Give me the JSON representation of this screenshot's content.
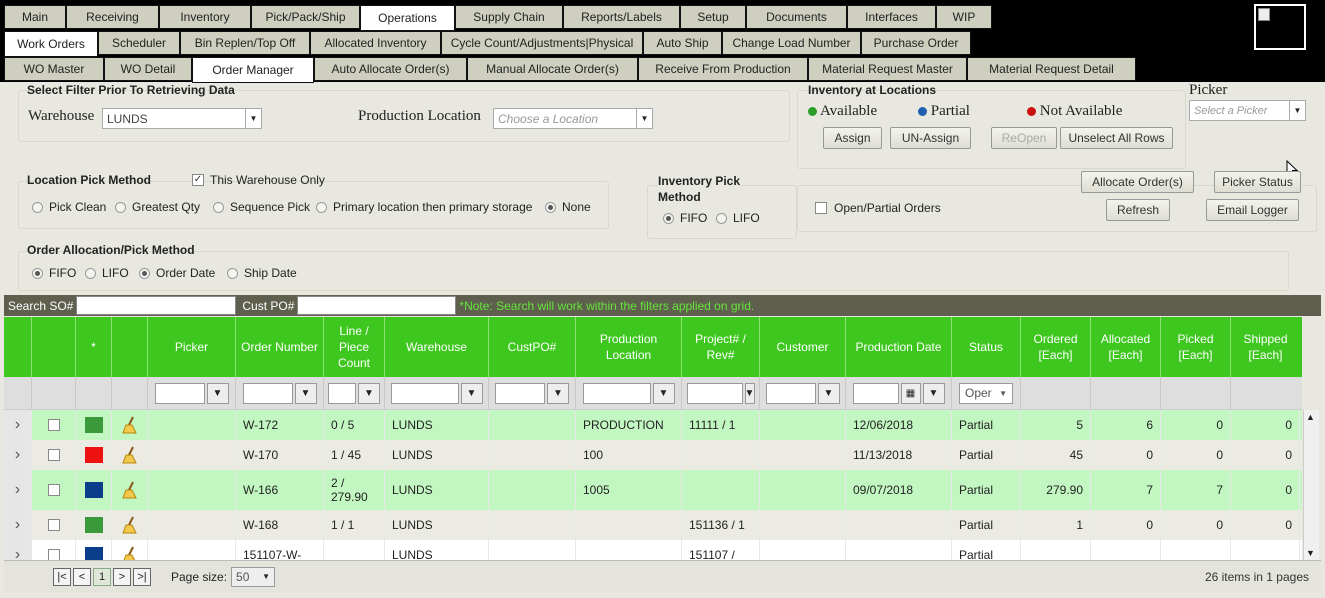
{
  "nav": {
    "main_tabs": [
      "Main",
      "Receiving",
      "Inventory",
      "Pick/Pack/Ship",
      "Operations",
      "Supply Chain",
      "Reports/Labels",
      "Setup",
      "Documents",
      "Interfaces",
      "WIP"
    ],
    "sub_tabs": [
      "Work Orders",
      "Scheduler",
      "Bin Replen/Top Off",
      "Allocated Inventory",
      "Cycle Count/Adjustments|Physical",
      "Auto Ship",
      "Change Load Number",
      "Purchase Order"
    ],
    "third_tabs": [
      "WO Master",
      "WO Detail",
      "Order Manager",
      "Auto Allocate Order(s)",
      "Manual Allocate Order(s)",
      "Receive From Production",
      "Material Request Master",
      "Material Request Detail"
    ]
  },
  "filters": {
    "section_title": "Select Filter Prior To Retrieving Data",
    "warehouse_label": "Warehouse",
    "warehouse_value": "LUNDS",
    "production_location_label": "Production Location",
    "production_location_placeholder": "Choose a Location"
  },
  "inventory_locations": {
    "title": "Inventory at Locations",
    "available": "Available",
    "partial": "Partial",
    "not_available": "Not Available",
    "assign": "Assign",
    "unassign": "UN-Assign",
    "reopen": "ReOpen",
    "unselect_all": "Unselect All Rows"
  },
  "picker": {
    "label": "Picker",
    "placeholder": "Select a Picker"
  },
  "location_pick": {
    "title": "Location Pick Method",
    "this_warehouse_only": "This Warehouse Only",
    "options": [
      "Pick Clean",
      "Greatest Qty",
      "Sequence Pick",
      "Primary location then primary storage",
      "None"
    ]
  },
  "inventory_pick": {
    "title_line1": "Inventory Pick",
    "title_line2": "Method",
    "fifo": "FIFO",
    "lifo": "LIFO"
  },
  "actions": {
    "allocate": "Allocate Order(s)",
    "picker_status": "Picker Status",
    "refresh": "Refresh",
    "email_logger": "Email Logger",
    "open_partial": "Open/Partial Orders"
  },
  "order_alloc": {
    "title": "Order Allocation/Pick Method",
    "options": [
      "FIFO",
      "LIFO",
      "Order Date",
      "Ship Date"
    ]
  },
  "search": {
    "so_label": "Search SO#",
    "po_label": "Cust PO#",
    "note": "*Note: Search will work within the filters applied on grid."
  },
  "grid": {
    "headers": [
      "",
      "",
      "*",
      "",
      "Picker",
      "Order Number",
      "Line / Piece Count",
      "Warehouse",
      "CustPO#",
      "Production Location",
      "Project# / Rev#",
      "Customer",
      "Production Date",
      "Status",
      "Ordered [Each]",
      "Allocated [Each]",
      "Picked [Each]",
      "Shipped [Each]"
    ],
    "status_filter": "Oper",
    "rows": [
      {
        "color": "#3a9a3a",
        "order": "W-172",
        "line": "0 / 5",
        "warehouse": "LUNDS",
        "custpo": "",
        "location": "PRODUCTION",
        "project": "11111 / 1",
        "customer": "",
        "date": "12/06/2018",
        "status": "Partial",
        "ordered": "5",
        "allocated": "6",
        "picked": "0",
        "shipped": "0"
      },
      {
        "color": "#ee1111",
        "order": "W-170",
        "line": "1 / 45",
        "warehouse": "LUNDS",
        "custpo": "",
        "location": "100",
        "project": "",
        "customer": "",
        "date": "11/13/2018",
        "status": "Partial",
        "ordered": "45",
        "allocated": "0",
        "picked": "0",
        "shipped": "0"
      },
      {
        "color": "#0a3d8a",
        "order": "W-166",
        "line": "2 / 279.90",
        "warehouse": "LUNDS",
        "custpo": "",
        "location": "1005",
        "project": "",
        "customer": "",
        "date": "09/07/2018",
        "status": "Partial",
        "ordered": "279.90",
        "allocated": "7",
        "picked": "7",
        "shipped": "0"
      },
      {
        "color": "#3a9a3a",
        "order": "W-168",
        "line": "1 / 1",
        "warehouse": "LUNDS",
        "custpo": "",
        "location": "",
        "project": "151136 / 1",
        "customer": "",
        "date": "",
        "status": "Partial",
        "ordered": "1",
        "allocated": "0",
        "picked": "0",
        "shipped": "0"
      },
      {
        "color": "#0a3d8a",
        "order": "151107-W-",
        "line": "",
        "warehouse": "LUNDS",
        "custpo": "",
        "location": "",
        "project": "151107 /",
        "customer": "",
        "date": "",
        "status": "Partial",
        "ordered": "",
        "allocated": "",
        "picked": "",
        "shipped": ""
      }
    ]
  },
  "pager": {
    "current_page": "1",
    "page_size_label": "Page size:",
    "page_size": "50",
    "summary": "26 items in 1 pages"
  }
}
